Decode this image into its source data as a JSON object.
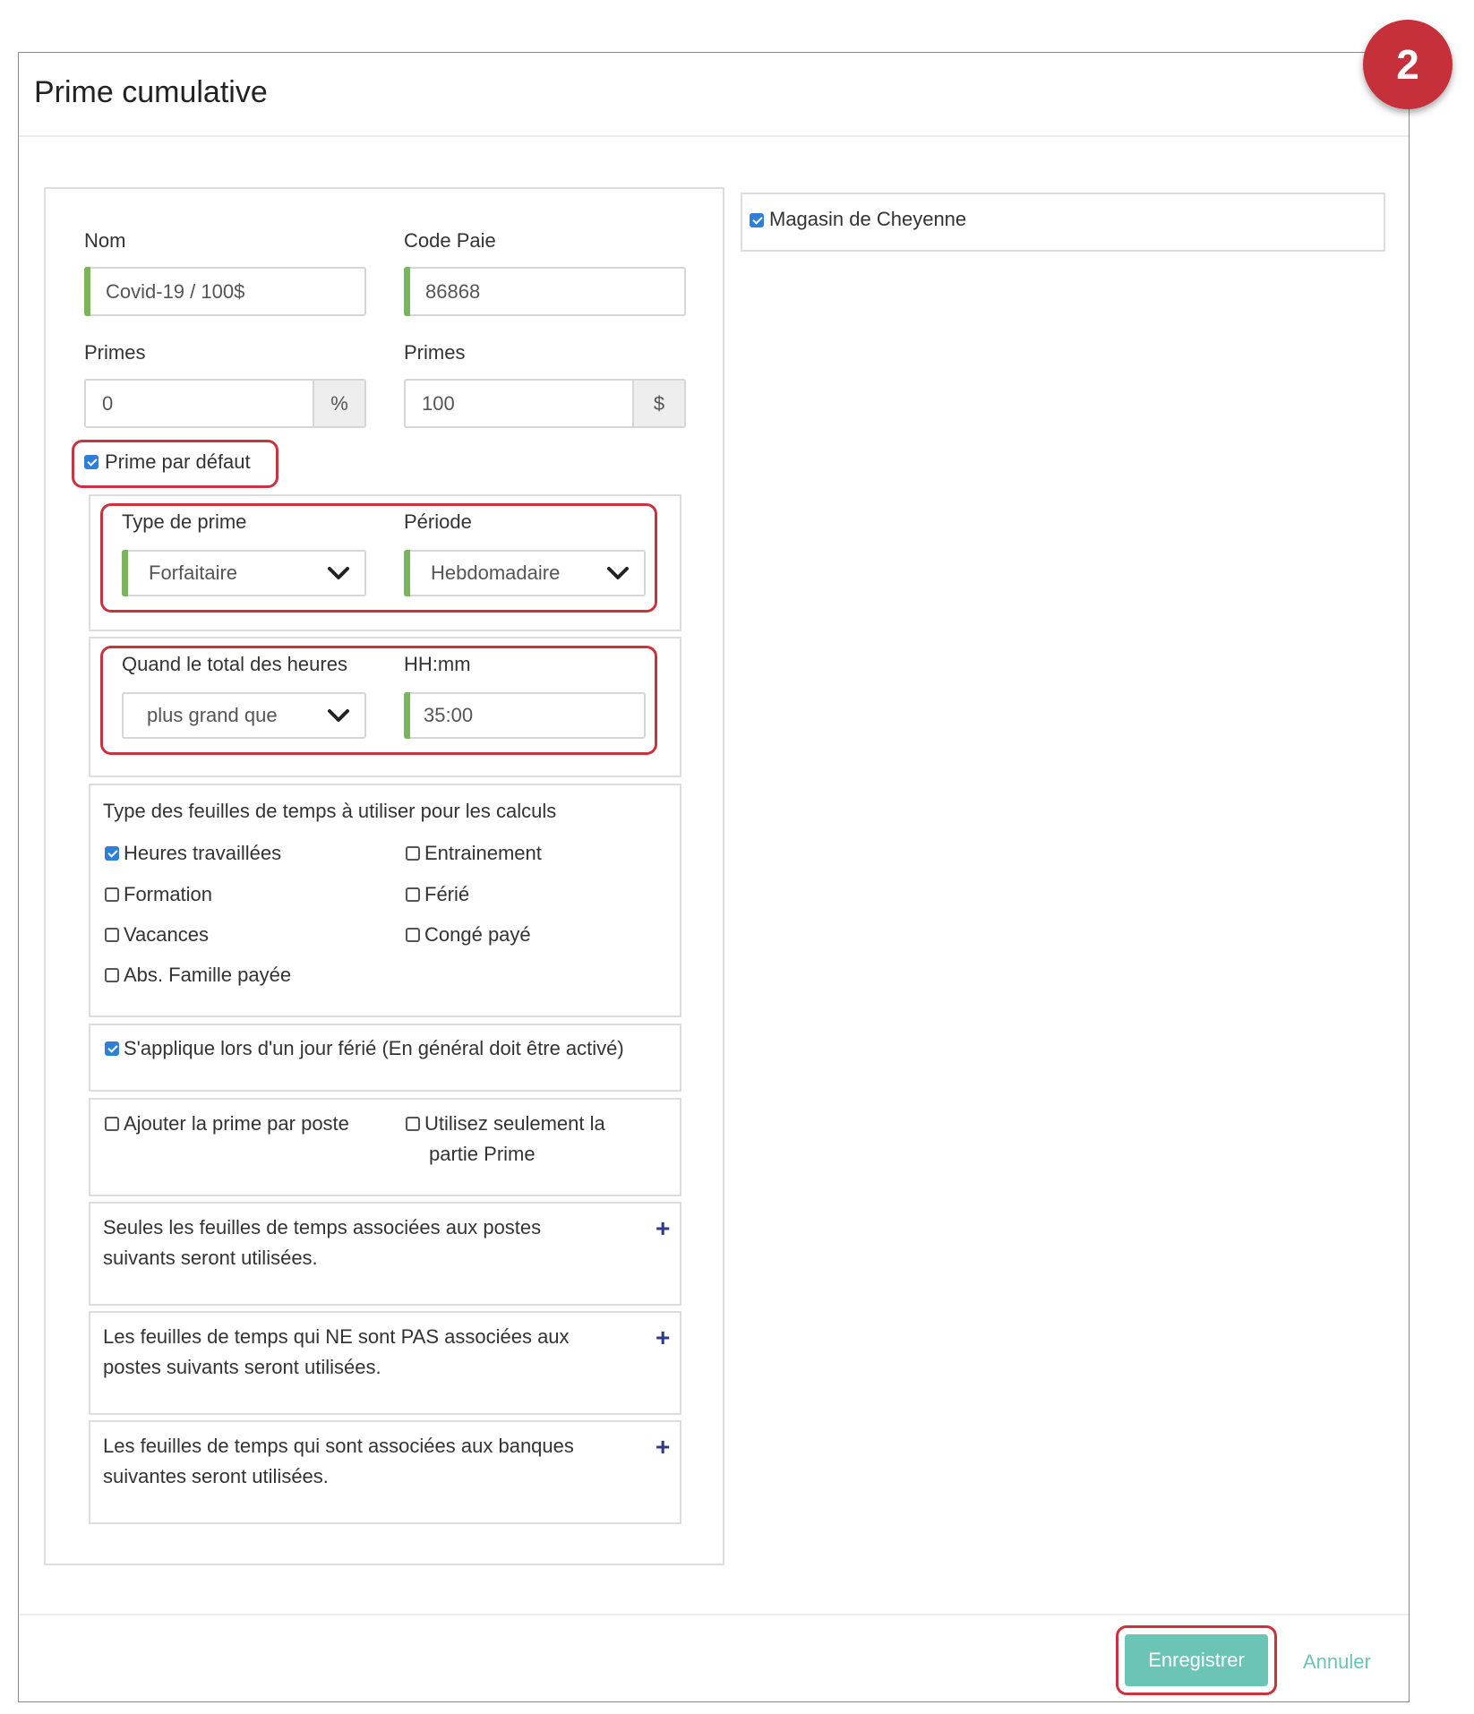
{
  "step_badge": "2",
  "modal": {
    "title": "Prime cumulative"
  },
  "form": {
    "nom_label": "Nom",
    "nom_value": "Covid-19 / 100$",
    "code_paie_label": "Code Paie",
    "code_paie_value": "86868",
    "primes_pct_label": "Primes",
    "primes_pct_value": "0",
    "primes_pct_unit": "%",
    "primes_amt_label": "Primes",
    "primes_amt_value": "100",
    "primes_amt_unit": "$",
    "prime_defaut_label": "Prime par défaut",
    "prime_defaut_checked": true,
    "type_prime_label": "Type de prime",
    "type_prime_value": "Forfaitaire",
    "periode_label": "Période",
    "periode_value": "Hebdomadaire",
    "quand_label": "Quand le total des heures",
    "quand_value": "plus grand que",
    "hhmm_label": "HH:mm",
    "hhmm_value": "35:00"
  },
  "timesheet_types": {
    "title": "Type des feuilles de temps à utiliser pour les calculs",
    "items": [
      {
        "label": "Heures travaillées",
        "checked": true
      },
      {
        "label": "Entrainement",
        "checked": false
      },
      {
        "label": "Formation",
        "checked": false
      },
      {
        "label": "Férié",
        "checked": false
      },
      {
        "label": "Vacances",
        "checked": false
      },
      {
        "label": "Congé payé",
        "checked": false
      },
      {
        "label": "Abs. Famille payée",
        "checked": false
      }
    ]
  },
  "holiday": {
    "label": "S'applique lors d'un jour férié (En général doit être activé)",
    "checked": true
  },
  "options": {
    "par_poste_label": "Ajouter la prime par poste",
    "par_poste_checked": false,
    "seulement_line1": "Utilisez seulement la",
    "seulement_line2": "partie Prime",
    "seulement_checked": false
  },
  "sections": [
    {
      "line1": "Seules les feuilles de temps associées aux postes",
      "line2": "suivants seront utilisées."
    },
    {
      "line1": "Les feuilles de temps qui NE sont PAS associées aux",
      "line2": "postes suivants seront utilisées."
    },
    {
      "line1": "Les feuilles de temps qui sont associées aux banques",
      "line2": "suivantes seront utilisées."
    }
  ],
  "store": {
    "label": "Magasin de Cheyenne",
    "checked": true
  },
  "footer": {
    "save_label": "Enregistrer",
    "cancel_label": "Annuler"
  },
  "colors": {
    "accent_green": "#7ab55c",
    "highlight_red": "#c9323f",
    "save_teal": "#6cc4b6",
    "checkbox_blue": "#2e7fd8",
    "plus_navy": "#2b3a8a"
  }
}
